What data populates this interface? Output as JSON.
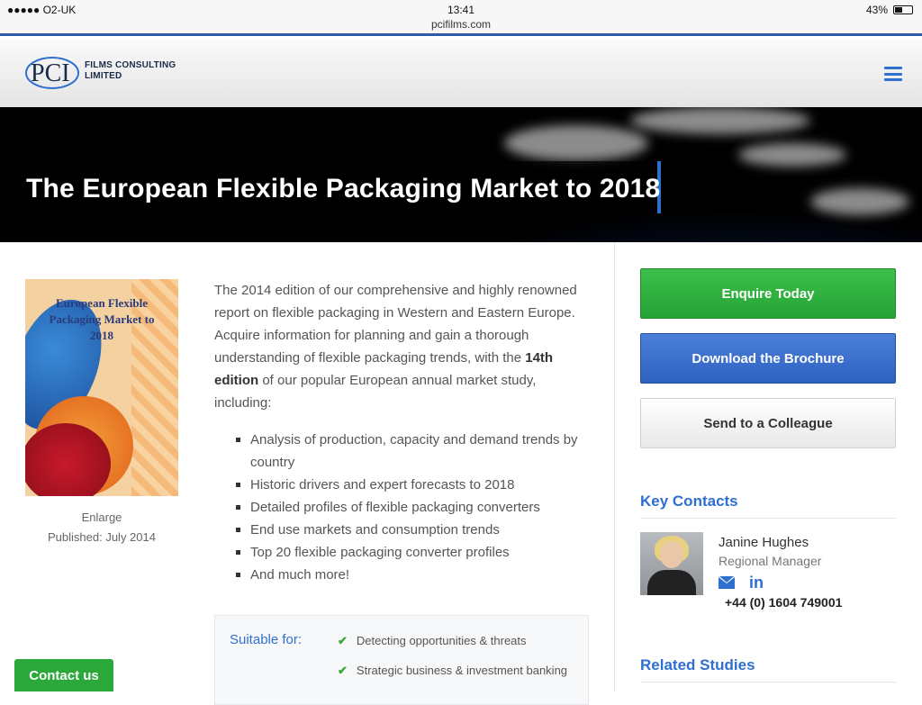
{
  "status_bar": {
    "carrier": "●●●●● O2-UK",
    "time": "13:41",
    "url": "pcifilms.com",
    "battery": "43%",
    "battery_level": 0.43
  },
  "header": {
    "logo_mark": "PCI",
    "logo_line1": "FILMS CONSULTING",
    "logo_line2": "LIMITED",
    "menu_icon": "hamburger-icon"
  },
  "hero": {
    "title": "The European Flexible Packaging Market to 2018"
  },
  "report": {
    "cover_title_line1": "European Flexible",
    "cover_title_line2": "Packaging Market to",
    "cover_title_line3": "2018",
    "enlarge_label": "Enlarge",
    "published": "Published: July 2014",
    "intro_before_bold": "The 2014 edition of our comprehensive and highly renowned report on flexible packaging in Western and Eastern Europe. Acquire information for planning and gain a thorough understanding of flexible packaging trends, with the ",
    "intro_bold": "14th edition",
    "intro_after_bold": " of our popular European annual market study, including:",
    "bullets": [
      "Analysis of production, capacity and demand trends by country",
      "Historic drivers and expert forecasts to 2018",
      "Detailed profiles of flexible packaging converters",
      "End use markets and consumption trends",
      "Top 20 flexible packaging converter profiles",
      "And much more!"
    ]
  },
  "suitable": {
    "label": "Suitable for:",
    "items": [
      "Detecting opportunities & threats",
      "Strategic business & investment banking"
    ]
  },
  "sidebar": {
    "enquire_label": "Enquire Today",
    "brochure_label": "Download the Brochure",
    "colleague_label": "Send to a Colleague",
    "key_contacts_heading": "Key Contacts",
    "contact_name": "Janine Hughes",
    "contact_role": "Regional Manager",
    "contact_phone": "+44 (0) 1604 749001",
    "related_heading": "Related Studies"
  },
  "floating": {
    "contact_us_label": "Contact us"
  },
  "colors": {
    "brand_blue": "#2f6fd0",
    "green": "#2aa83a"
  }
}
